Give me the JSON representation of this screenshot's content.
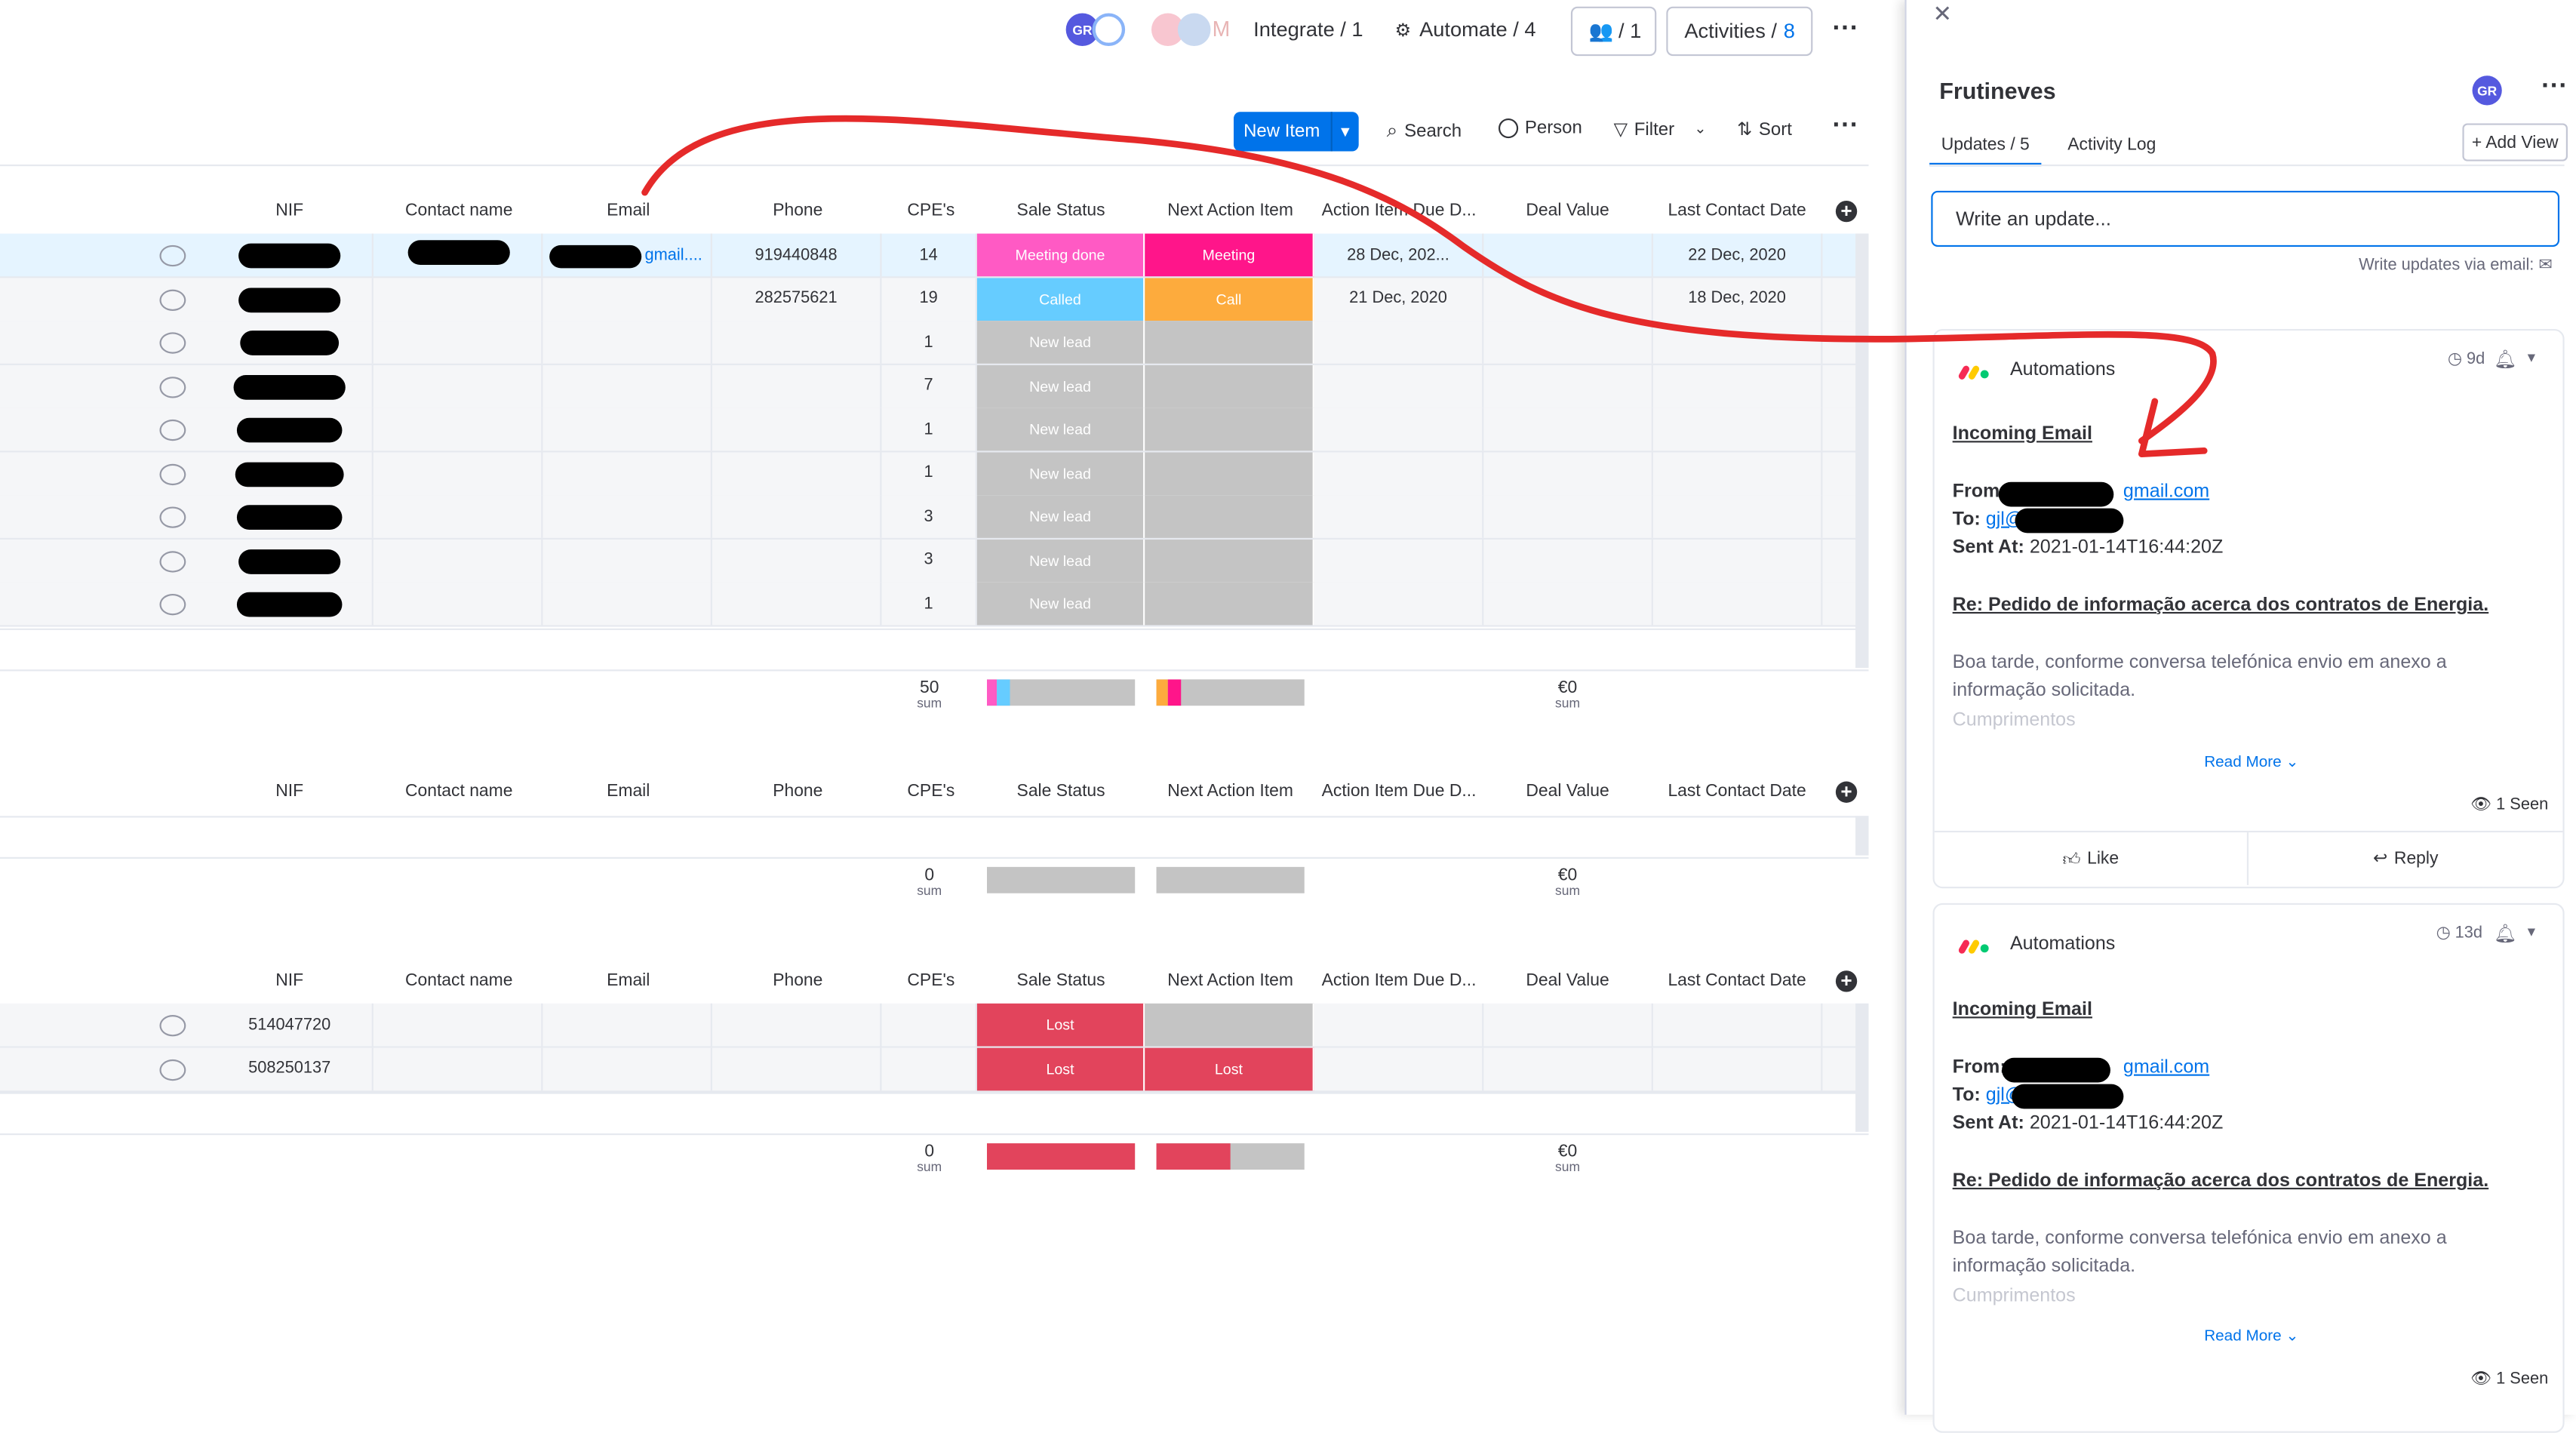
{
  "topbar": {
    "avatar_initials": "GR",
    "integrate_label": "Integrate / 1",
    "automate_label": "Automate / 4",
    "members_label": "/ 1",
    "activities_label": "Activities /",
    "activities_count": "8"
  },
  "toolbar": {
    "new_item_label": "New Item",
    "search_label": "Search",
    "person_label": "Person",
    "filter_label": "Filter",
    "sort_label": "Sort"
  },
  "columns": [
    "NIF",
    "Contact name",
    "Email",
    "Phone",
    "CPE's",
    "Sale Status",
    "Next Action Item",
    "Action Item Due D...",
    "Deal Value",
    "Last Contact Date"
  ],
  "groups": [
    {
      "rows": [
        {
          "nif": "",
          "email": "gmail....",
          "phone": "919440848",
          "cpes": "14",
          "sale_status": "Meeting done",
          "sale_color": "#ff5ac4",
          "next_action": "Meeting",
          "next_color": "#ff158a",
          "due": "28 Dec, 202...",
          "last": "22 Dec, 2020"
        },
        {
          "nif": "",
          "email": "",
          "phone": "282575621",
          "cpes": "19",
          "sale_status": "Called",
          "sale_color": "#66ccff",
          "next_action": "Call",
          "next_color": "#fdab3d",
          "due": "21 Dec, 2020",
          "last": "18 Dec, 2020"
        },
        {
          "nif": "",
          "email": "",
          "phone": "",
          "cpes": "1",
          "sale_status": "New lead",
          "sale_color": "#c4c4c4",
          "next_action": "",
          "next_color": "#c4c4c4",
          "due": "",
          "last": ""
        },
        {
          "nif": "",
          "email": "",
          "phone": "",
          "cpes": "7",
          "sale_status": "New lead",
          "sale_color": "#c4c4c4",
          "next_action": "",
          "next_color": "#c4c4c4",
          "due": "",
          "last": ""
        },
        {
          "nif": "",
          "email": "",
          "phone": "",
          "cpes": "1",
          "sale_status": "New lead",
          "sale_color": "#c4c4c4",
          "next_action": "",
          "next_color": "#c4c4c4",
          "due": "",
          "last": ""
        },
        {
          "nif": "",
          "email": "",
          "phone": "",
          "cpes": "1",
          "sale_status": "New lead",
          "sale_color": "#c4c4c4",
          "next_action": "",
          "next_color": "#c4c4c4",
          "due": "",
          "last": ""
        },
        {
          "nif": "",
          "email": "",
          "phone": "",
          "cpes": "3",
          "sale_status": "New lead",
          "sale_color": "#c4c4c4",
          "next_action": "",
          "next_color": "#c4c4c4",
          "due": "",
          "last": ""
        },
        {
          "nif": "",
          "email": "",
          "phone": "",
          "cpes": "3",
          "sale_status": "New lead",
          "sale_color": "#c4c4c4",
          "next_action": "",
          "next_color": "#c4c4c4",
          "due": "",
          "last": ""
        },
        {
          "nif": "",
          "email": "",
          "phone": "",
          "cpes": "1",
          "sale_status": "New lead",
          "sale_color": "#c4c4c4",
          "next_action": "",
          "next_color": "#c4c4c4",
          "due": "",
          "last": ""
        }
      ],
      "summary": {
        "cpes_sum": "50",
        "sum_label": "sum",
        "deal_sum": "€0"
      }
    },
    {
      "rows": [],
      "summary": {
        "cpes_sum": "0",
        "sum_label": "sum",
        "deal_sum": "€0"
      }
    },
    {
      "rows": [
        {
          "nif": "514047720",
          "email": "",
          "phone": "",
          "cpes": "",
          "sale_status": "Lost",
          "sale_color": "#e2445c",
          "next_action": "",
          "next_color": "#c4c4c4",
          "due": "",
          "last": ""
        },
        {
          "nif": "508250137",
          "email": "",
          "phone": "",
          "cpes": "",
          "sale_status": "Lost",
          "sale_color": "#e2445c",
          "next_action": "Lost",
          "next_color": "#e2445c",
          "due": "",
          "last": ""
        }
      ],
      "summary": {
        "cpes_sum": "0",
        "sum_label": "sum",
        "deal_sum": "€0"
      }
    }
  ],
  "panel": {
    "title": "Frutineves",
    "avatar_initials": "GR",
    "tabs": [
      "Updates / 5",
      "Activity Log"
    ],
    "add_view_label": "+ Add View",
    "write_placeholder": "Write an update...",
    "email_hint": "Write updates via email:",
    "updates": [
      {
        "author": "Automations",
        "age": "9d",
        "heading": "Incoming Email",
        "from_label": "From:",
        "from_value": "gmail.com",
        "to_label": "To:",
        "to_value": "gjl@",
        "sent_label": "Sent At:",
        "sent_value": "2021-01-14T16:44:20Z",
        "subject": "Re: Pedido de informação acerca dos contratos de Energia.",
        "body_line1": "Boa tarde, conforme conversa telefónica envio em anexo a",
        "body_line2": "informação solicitada.",
        "body_line3": "Cumprimentos",
        "read_more": "Read More",
        "seen": "1 Seen",
        "like_label": "Like",
        "reply_label": "Reply"
      },
      {
        "author": "Automations",
        "age": "13d",
        "heading": "Incoming Email",
        "from_label": "From:",
        "from_value": "gmail.com",
        "to_label": "To:",
        "to_value": "gjl@",
        "sent_label": "Sent At:",
        "sent_value": "2021-01-14T16:44:20Z",
        "subject": "Re: Pedido de informação acerca dos contratos de Energia.",
        "body_line1": "Boa tarde, conforme conversa telefónica envio em anexo a",
        "body_line2": "informação solicitada.",
        "body_line3": "Cumprimentos",
        "read_more": "Read More",
        "seen": "1 Seen"
      }
    ]
  },
  "colors": {
    "primary": "#0073ea",
    "annotation": "#e52a2a"
  }
}
